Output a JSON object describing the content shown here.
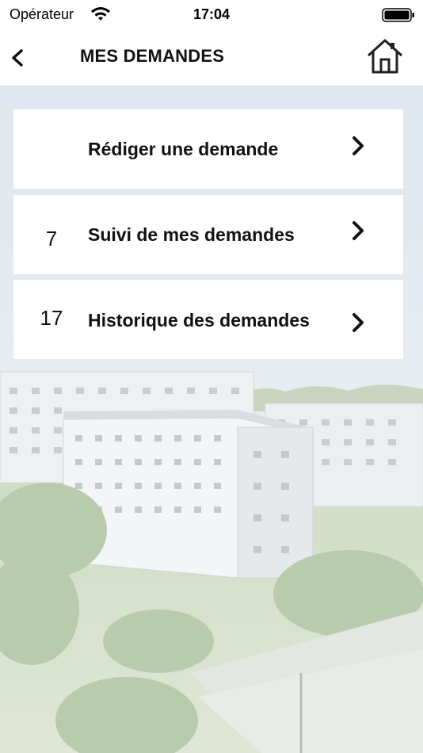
{
  "status_bar": {
    "carrier": "Opérateur",
    "time": "17:04",
    "wifi_icon": "wifi-icon",
    "battery_icon": "battery-icon"
  },
  "nav": {
    "title": "MES DEMANDES",
    "back_icon": "chevron-left-icon",
    "home_icon": "home-icon"
  },
  "menu": {
    "items": [
      {
        "label": "Rédiger une demande",
        "count": ""
      },
      {
        "label": "Suivi de mes demandes",
        "count": "7"
      },
      {
        "label": "Historique des demandes",
        "count": "17"
      }
    ]
  },
  "colors": {
    "card": "#ffffff",
    "text": "#111111",
    "sky": "#e6ecf2"
  }
}
